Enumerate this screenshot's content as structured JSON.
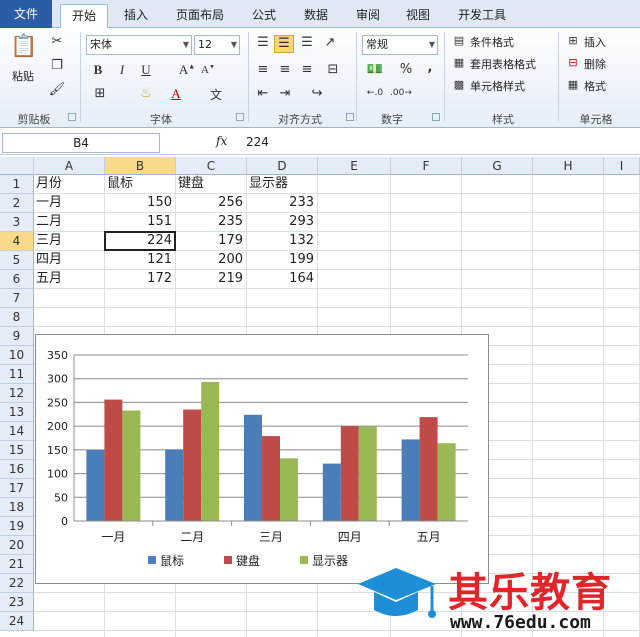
{
  "ribbon": {
    "tabs": [
      "文件",
      "开始",
      "插入",
      "页面布局",
      "公式",
      "数据",
      "审阅",
      "视图",
      "开发工具"
    ],
    "active_tab": "开始",
    "groups": {
      "clipboard": {
        "label": "剪贴板",
        "paste": "粘贴"
      },
      "font": {
        "label": "字体",
        "font_name": "宋体",
        "font_size": "12",
        "bold": "B",
        "italic": "I",
        "underline": "U"
      },
      "alignment": {
        "label": "对齐方式"
      },
      "number": {
        "label": "数字",
        "format": "常规",
        "percent": "%",
        "comma": ","
      },
      "styles": {
        "label": "样式",
        "conditional": "条件格式",
        "table_format": "套用表格格式",
        "cell_styles": "单元格样式"
      },
      "cells": {
        "label": "单元格",
        "insert": "插入",
        "delete": "删除",
        "format": "格式"
      }
    }
  },
  "formula_bar": {
    "name_box": "B4",
    "fx": "fx",
    "value": "224"
  },
  "grid": {
    "columns": [
      "A",
      "B",
      "C",
      "D",
      "E",
      "F",
      "G",
      "H",
      "I"
    ],
    "rows": [
      "1",
      "2",
      "3",
      "4",
      "5",
      "6",
      "7",
      "8",
      "9",
      "10",
      "11",
      "12",
      "13",
      "14",
      "15",
      "16",
      "17",
      "18",
      "19",
      "20",
      "21",
      "22",
      "23",
      "24"
    ],
    "selected_col": "B",
    "selected_row": "4",
    "data": [
      [
        "月份",
        "鼠标",
        "键盘",
        "显示器"
      ],
      [
        "一月",
        "150",
        "256",
        "233"
      ],
      [
        "二月",
        "151",
        "235",
        "293"
      ],
      [
        "三月",
        "224",
        "179",
        "132"
      ],
      [
        "四月",
        "121",
        "200",
        "199"
      ],
      [
        "五月",
        "172",
        "219",
        "164"
      ]
    ]
  },
  "colors": {
    "series1": "#4a7ebb",
    "series2": "#be4b48",
    "series3": "#98b954",
    "accent": "#2a5ca8"
  },
  "chart_data": {
    "type": "bar",
    "categories": [
      "一月",
      "二月",
      "三月",
      "四月",
      "五月"
    ],
    "series": [
      {
        "name": "鼠标",
        "values": [
          150,
          151,
          224,
          121,
          172
        ]
      },
      {
        "name": "键盘",
        "values": [
          256,
          235,
          179,
          200,
          219
        ]
      },
      {
        "name": "显示器",
        "values": [
          233,
          293,
          132,
          199,
          164
        ]
      }
    ],
    "ylim": [
      0,
      350
    ],
    "yticks": [
      "0",
      "50",
      "100",
      "150",
      "200",
      "250",
      "300",
      "350"
    ],
    "grid": true,
    "legend": "bottom",
    "title": "",
    "xlabel": "",
    "ylabel": ""
  },
  "watermark": {
    "brand": "其乐教育",
    "url": "www.76edu.com"
  }
}
